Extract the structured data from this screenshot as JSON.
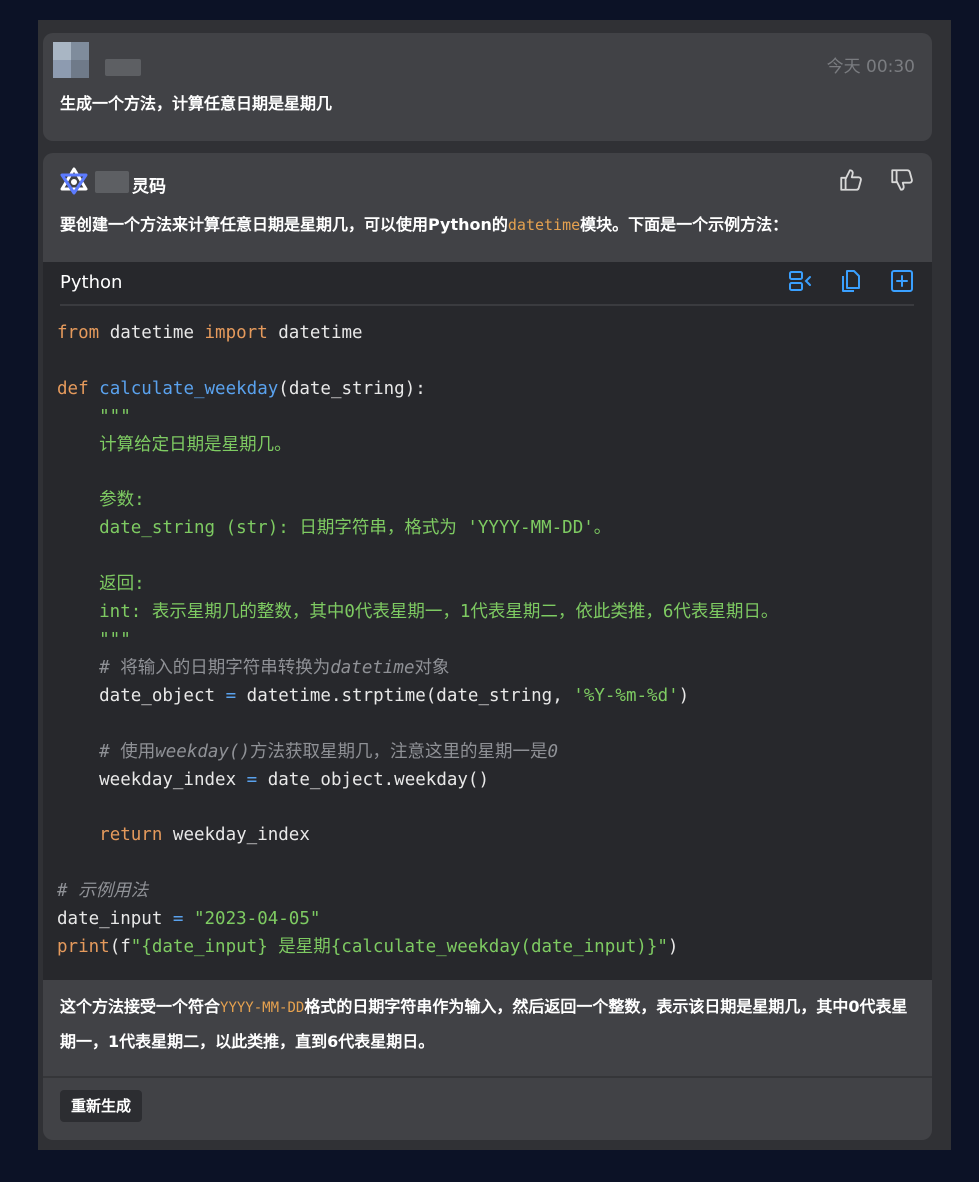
{
  "colors": {
    "background": "#0c1226",
    "card": "#414246",
    "code_background": "#27282c",
    "keyword": "#e59a5c",
    "function": "#5aa2ee",
    "string": "#7ecb62",
    "comment": "#8f9196",
    "accent": "#3aa0ff"
  },
  "user_message": {
    "timestamp": "今天 00:30",
    "text": "生成一个方法，计算任意日期是星期几"
  },
  "bot_message": {
    "name": "灵码",
    "intro_before": "要创建一个方法来计算任意日期是星期几，可以使用Python的",
    "intro_code": "datetime",
    "intro_after": "模块。下面是一个示例方法：",
    "icons": [
      "logo-icon",
      "thumbs-up-icon",
      "thumbs-down-icon"
    ],
    "code_block": {
      "language": "Python",
      "toolbar_icons": [
        "insert-diff-icon",
        "copy-icon",
        "insert-code-icon"
      ],
      "tokens": {
        "l1_from": "from",
        "l1_mod": " datetime ",
        "l1_import": "import",
        "l1_name": " datetime",
        "l3_def": "def",
        "l3_fn": "calculate_weekday",
        "l3_args": "(date_string):",
        "doc_open": "    \"\"\"",
        "doc_1": "    计算给定日期是星期几。",
        "doc_params": "    参数:",
        "doc_param_1": "    date_string (str): 日期字符串，格式为 'YYYY-MM-DD'。",
        "doc_returns": "    返回:",
        "doc_return_1": "    int: 表示星期几的整数，其中0代表星期一，1代表星期二，依此类推，6代表星期日。",
        "doc_close": "    \"\"\"",
        "c1_hash": "    # 将输入的日期字符串转换为",
        "c1_it": "datetime",
        "c1_end": "对象",
        "l14_var": "    date_object ",
        "l14_eq": "=",
        "l14_call": " datetime.strptime(date_string, ",
        "l14_str": "'%Y-%m-%d'",
        "l14_end": ")",
        "c2_hash": "    # 使用",
        "c2_it": "weekday()",
        "c2_mid": "方法获取星期几，注意这里的星期一是",
        "c2_zero": "0",
        "l17_var": "    weekday_index ",
        "l17_eq": "=",
        "l17_call": " date_object.weekday()",
        "l19_indent": "    ",
        "l19_return": "return",
        "l19_name": " weekday_index",
        "c3": "# 示例用法",
        "l22_var": "date_input ",
        "l22_eq": "=",
        "l22_str": " \"2023-04-05\"",
        "l23_print": "print",
        "l23_open": "(f",
        "l23_str": "\"{date_input} 是星期{calculate_weekday(date_input)}\"",
        "l23_close": ")"
      }
    },
    "outro_before": "这个方法接受一个符合",
    "outro_code": "YYYY-MM-DD",
    "outro_after": "格式的日期字符串作为输入，然后返回一个整数，表示该日期是星期几，其中0代表星期一，1代表星期二，以此类推，直到6代表星期日。",
    "regenerate_label": "重新生成"
  }
}
